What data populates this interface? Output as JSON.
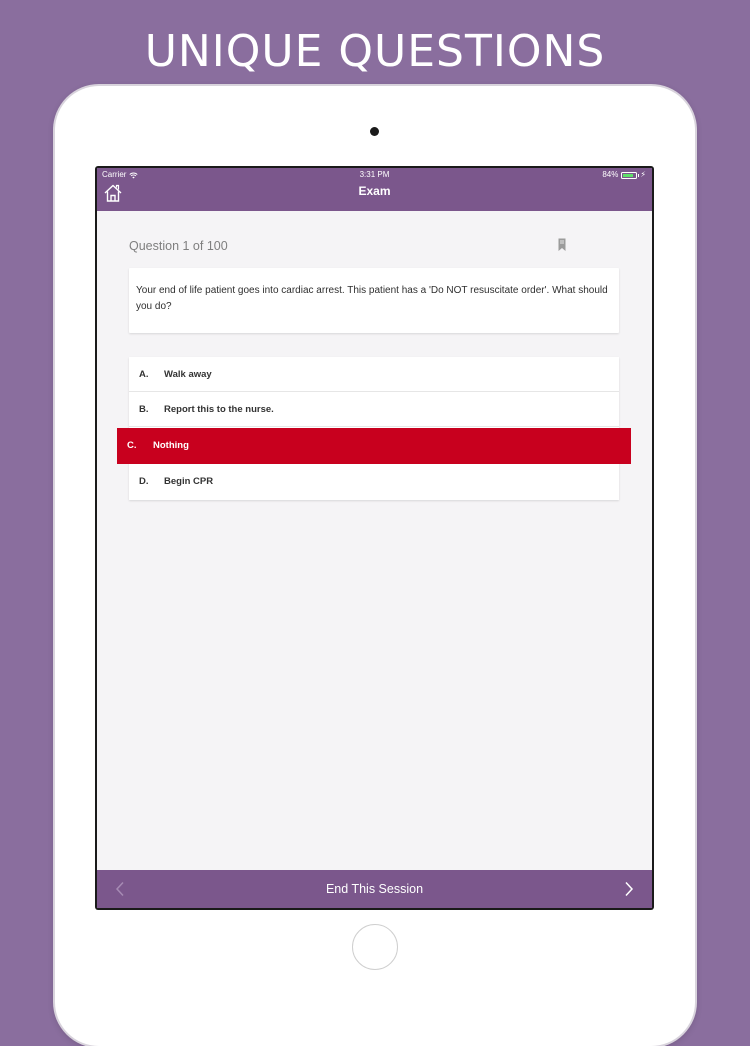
{
  "headline": "UNIQUE QUESTIONS",
  "status_bar": {
    "carrier": "Carrier",
    "time": "3:31 PM",
    "battery": "84%",
    "battery_level": 0.84
  },
  "navbar": {
    "title": "Exam",
    "home_icon": "home-icon"
  },
  "question": {
    "counter": "Question 1 of 100",
    "text": "Your end of life patient goes into cardiac arrest. This patient has a 'Do NOT resuscitate order'. What should you do?",
    "bookmark_icon": "bookmark-icon"
  },
  "answers": [
    {
      "letter": "A.",
      "text": "Walk away"
    },
    {
      "letter": "B.",
      "text": "Report this to the nurse."
    },
    {
      "letter": "C.",
      "text": "Nothing"
    },
    {
      "letter": "D.",
      "text": "Begin CPR"
    }
  ],
  "selected_answer": "C.",
  "footer": {
    "end_session_label": "End This Session",
    "prev_icon": "chevron-left-icon",
    "next_icon": "chevron-right-icon"
  },
  "colors": {
    "background": "#8a6e9e",
    "bar": "#7b578c",
    "selected": "#c8001e"
  }
}
